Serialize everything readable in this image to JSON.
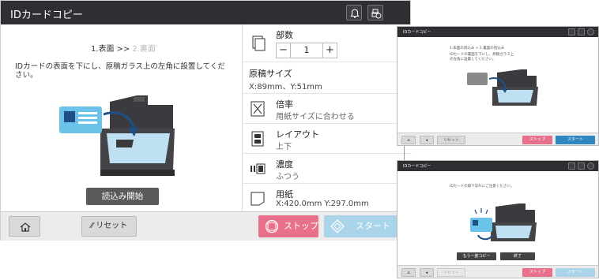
{
  "main": {
    "title": "IDカードコピー",
    "steps": {
      "current": "1.表面",
      "separator": ">>",
      "next": "2.裏面"
    },
    "instruction": "IDカードの表面を下にし、原稿ガラス上の左角に設置してください。",
    "read_button": "読込み開始",
    "settings": {
      "copies": {
        "label": "部数",
        "value": "1",
        "minus": "−",
        "plus": "+"
      },
      "original_size": {
        "label": "原稿サイズ",
        "value": "X:89mm、Y:51mm"
      },
      "zoom": {
        "label": "倍率",
        "value": "用紙サイズに合わせる"
      },
      "layout": {
        "label": "レイアウト",
        "value": "上下"
      },
      "density": {
        "label": "濃度",
        "value": "ふつう"
      },
      "paper": {
        "label": "用紙",
        "value": "X:420.0mm  Y:297.0mm"
      }
    },
    "bottom": {
      "reset": "リセット",
      "stop": "ストップ",
      "start": "スタート"
    }
  },
  "mini1": {
    "title": "IDカードコピー",
    "steps": "1.表面の読込み > 2.裏面の読込み",
    "instruction": "IDカードの裏面を下にし、原稿ガラス上の左角に設置してください。",
    "bottom": {
      "reset": "リセット",
      "stop": "ストップ",
      "start": "スタート"
    }
  },
  "mini2": {
    "title": "IDカードコピー",
    "message": "IDカードの取り忘れにご注意ください。",
    "again_button": "もう一度コピー",
    "end_button": "終了",
    "bottom": {
      "reset": "リセット",
      "stop": "ストップ",
      "start": "スタート"
    }
  },
  "colors": {
    "titlebar": "#2f2f33",
    "stop": "#e8708a",
    "start": "#a9d4ea",
    "card": "#6cc3ea"
  }
}
